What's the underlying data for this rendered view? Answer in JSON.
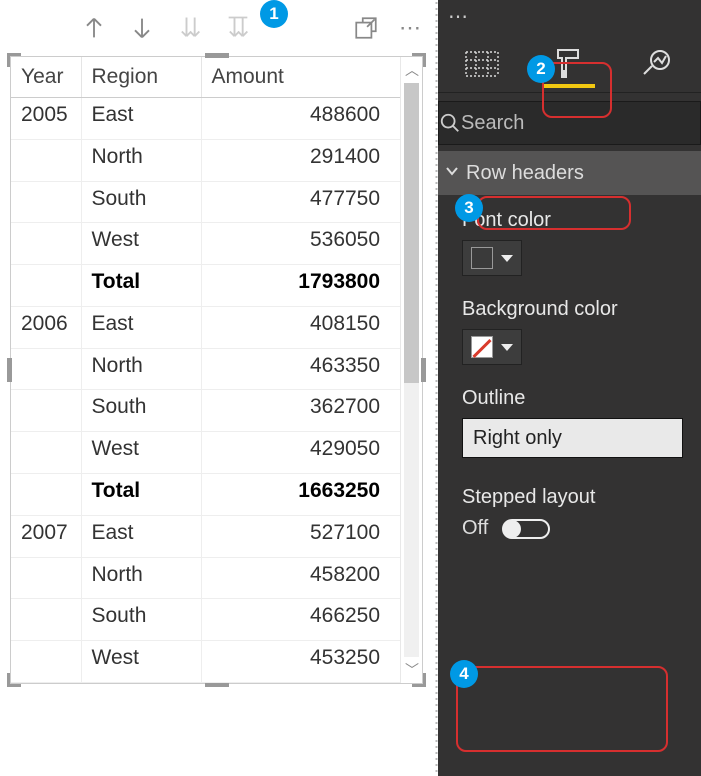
{
  "callouts": {
    "c1": "1",
    "c2": "2",
    "c3": "3",
    "c4": "4"
  },
  "toolbar": {
    "more": "⋯"
  },
  "table": {
    "headers": {
      "year": "Year",
      "region": "Region",
      "amount": "Amount"
    },
    "rows": [
      {
        "year": "2005",
        "region": "East",
        "amount": "488600"
      },
      {
        "year": "",
        "region": "North",
        "amount": "291400"
      },
      {
        "year": "",
        "region": "South",
        "amount": "477750"
      },
      {
        "year": "",
        "region": "West",
        "amount": "536050"
      },
      {
        "year": "",
        "region": "Total",
        "amount": "1793800",
        "total": true
      },
      {
        "year": "2006",
        "region": "East",
        "amount": "408150"
      },
      {
        "year": "",
        "region": "North",
        "amount": "463350"
      },
      {
        "year": "",
        "region": "South",
        "amount": "362700"
      },
      {
        "year": "",
        "region": "West",
        "amount": "429050"
      },
      {
        "year": "",
        "region": "Total",
        "amount": "1663250",
        "total": true
      },
      {
        "year": "2007",
        "region": "East",
        "amount": "527100"
      },
      {
        "year": "",
        "region": "North",
        "amount": "458200"
      },
      {
        "year": "",
        "region": "South",
        "amount": "466250"
      },
      {
        "year": "",
        "region": "West",
        "amount": "453250"
      }
    ]
  },
  "panel": {
    "search_placeholder": "Search",
    "section": "Row headers",
    "font_color_label": "Font color",
    "background_color_label": "Background color",
    "outline_label": "Outline",
    "outline_value": "Right only",
    "stepped_label": "Stepped layout",
    "stepped_state": "Off"
  },
  "colors": {
    "accent": "#f2c811",
    "callout": "#0099e5",
    "highlight": "#d62f2f"
  }
}
